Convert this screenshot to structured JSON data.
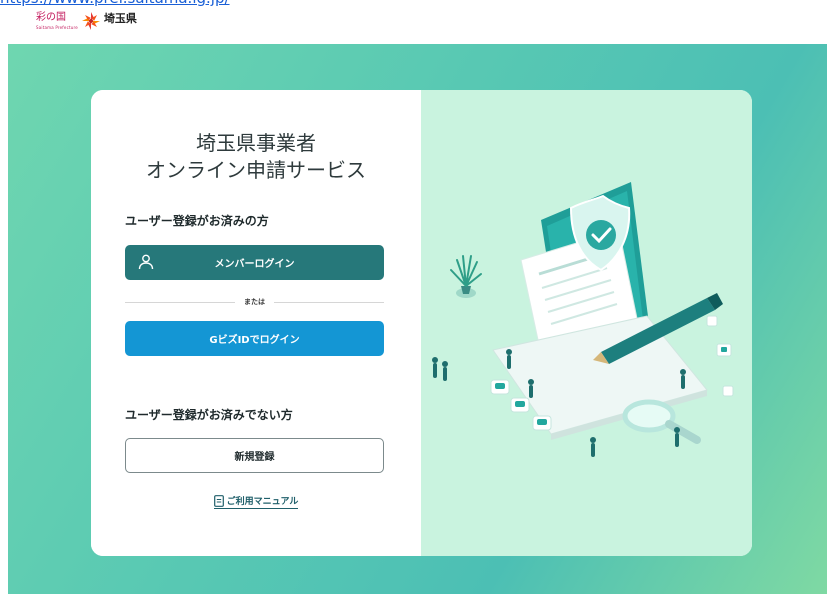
{
  "header": {
    "url_text": "https://www.pref.saitama.lg.jp/",
    "logo_irono": "彩の国",
    "logo_sub": "Saitama Prefecture",
    "logo_pref": "埼玉県"
  },
  "login": {
    "title_line1": "埼玉県事業者",
    "title_line2": "オンライン申請サービス",
    "registered_heading": "ユーザー登録がお済みの方",
    "member_login_label": "メンバーログイン",
    "or_label": "または",
    "gbiz_login_label": "GビズIDでログイン",
    "unregistered_heading": "ユーザー登録がお済みでない方",
    "new_register_label": "新規登録",
    "manual_label": "ご利用マニュアル"
  },
  "colors": {
    "member_button": "#26787a",
    "gbiz_button": "#1496d4",
    "illustration_bg": "#c9f3df",
    "page_bg": "#59c9b3"
  },
  "icons": [
    "user-icon",
    "document-icon",
    "shield-check-icon",
    "pen-icon",
    "magnifier-icon",
    "plant-icon",
    "laptop-icon"
  ]
}
